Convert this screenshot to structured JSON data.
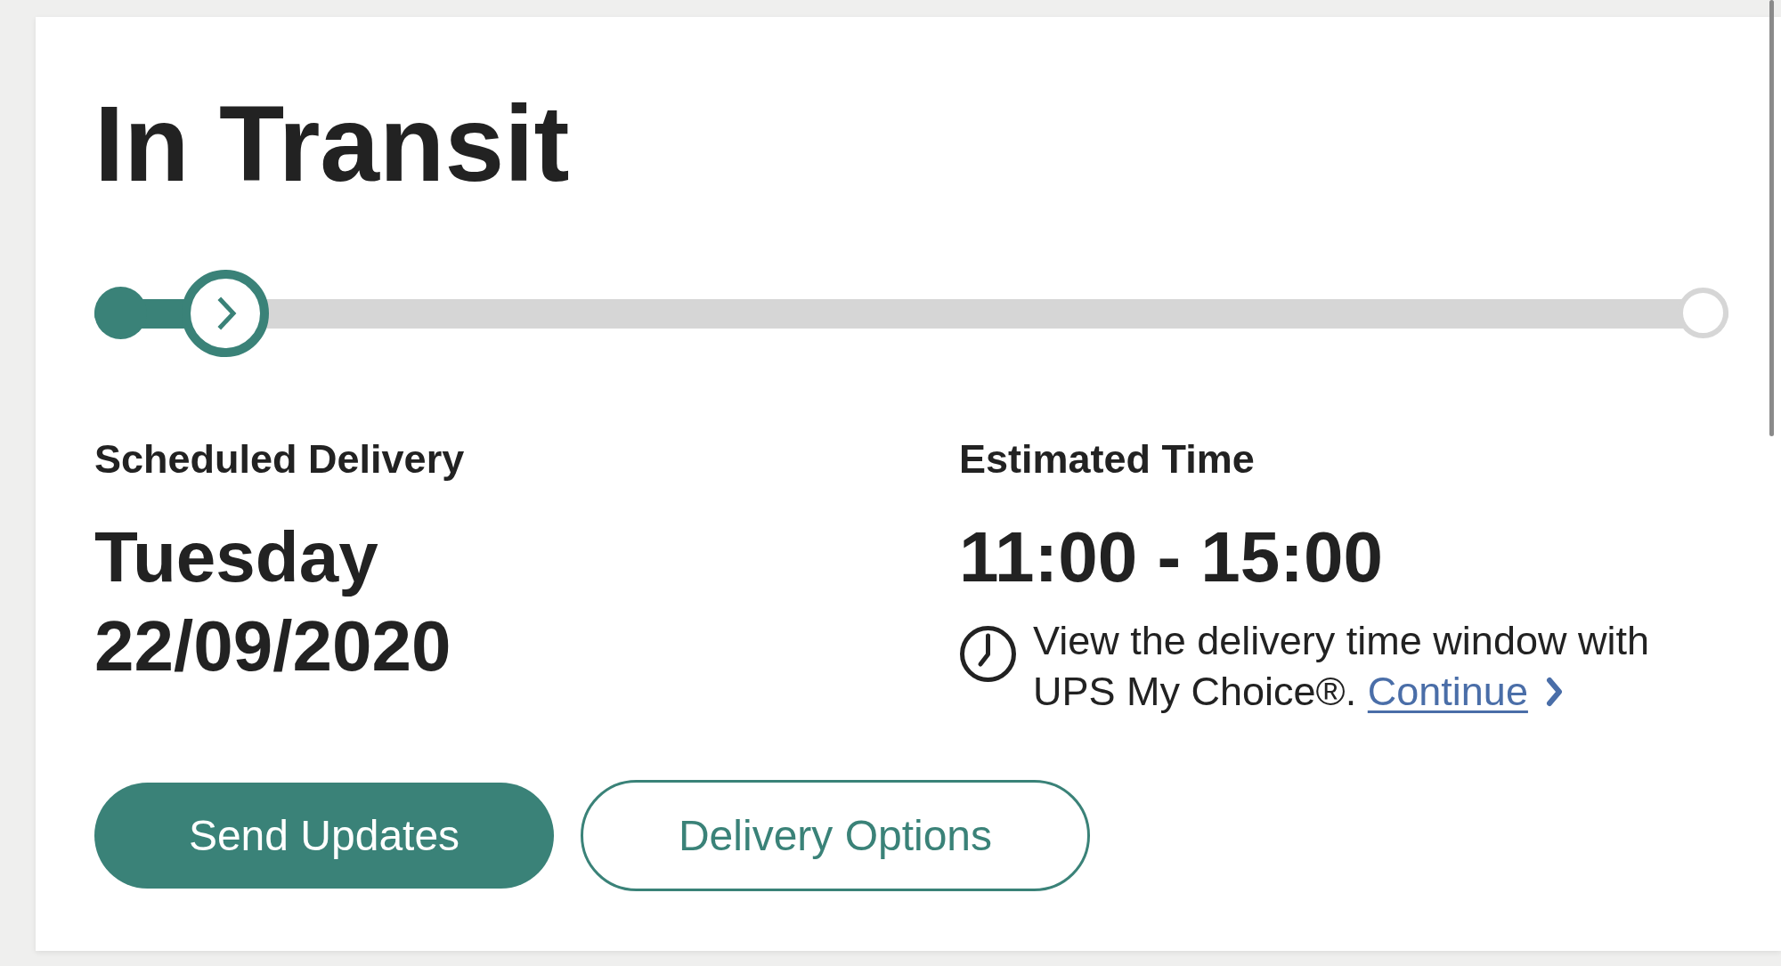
{
  "heading": "In Transit",
  "tracker": {
    "level": 0.08,
    "markers": [
      {
        "kind": "start"
      },
      {
        "kind": "current"
      },
      {
        "kind": "end"
      }
    ]
  },
  "details": [
    {
      "label": "Scheduled Delivery",
      "value": "Tuesday 22/09/2020"
    },
    {
      "label": "Estimated Time",
      "value": "11:00 - 15:00",
      "note": {
        "text": "View the delivery time window with UPS My Choice®.",
        "link": "Continue"
      }
    }
  ],
  "buttons": [
    {
      "label": "Send Updates",
      "kind": "primary"
    },
    {
      "label": "Delivery Options",
      "kind": "secondary"
    }
  ]
}
